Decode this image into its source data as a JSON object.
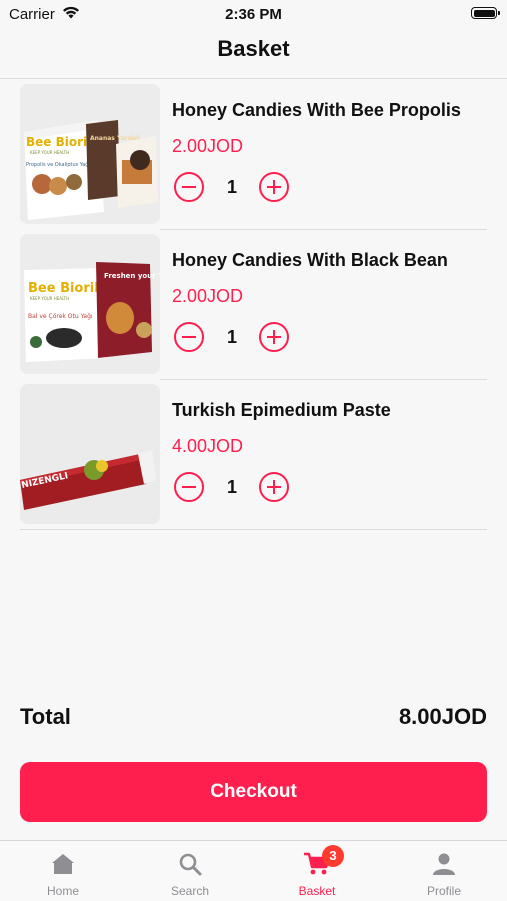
{
  "status_bar": {
    "carrier": "Carrier",
    "time": "2:36 PM"
  },
  "header": {
    "title": "Basket"
  },
  "cart": {
    "items": [
      {
        "name": "Honey Candies With Bee Propolis",
        "price": "2.00JOD",
        "quantity": "1",
        "image": {
          "brand": "Bee Biorik",
          "tagline": "KEEP YOUR HEALTH",
          "pack": "Propolis ve Okaliptus Yağı",
          "box": "Ananas Yardalı"
        }
      },
      {
        "name": "Honey Candies With Black Bean",
        "price": "2.00JOD",
        "quantity": "1",
        "image": {
          "brand": "Bee Biorik",
          "tagline": "KEEP YOUR HEALTH",
          "pack": "Bal ve Çörek Otu Yağı",
          "box": "Freshen your Throat"
        }
      },
      {
        "name": "Turkish Epimedium Paste",
        "price": "4.00JOD",
        "quantity": "1",
        "image": {
          "tube": "NIZENGLI"
        }
      }
    ]
  },
  "summary": {
    "total_label": "Total",
    "total_value": "8.00JOD"
  },
  "checkout": {
    "label": "Checkout"
  },
  "tabs": [
    {
      "label": "Home",
      "icon": "home-icon"
    },
    {
      "label": "Search",
      "icon": "search-icon"
    },
    {
      "label": "Basket",
      "icon": "cart-icon",
      "badge": "3",
      "active": true
    },
    {
      "label": "Profile",
      "icon": "person-icon"
    }
  ],
  "colors": {
    "accent": "#ff1f4e",
    "badge": "#ff3b30",
    "inactive": "#8e8e93"
  }
}
